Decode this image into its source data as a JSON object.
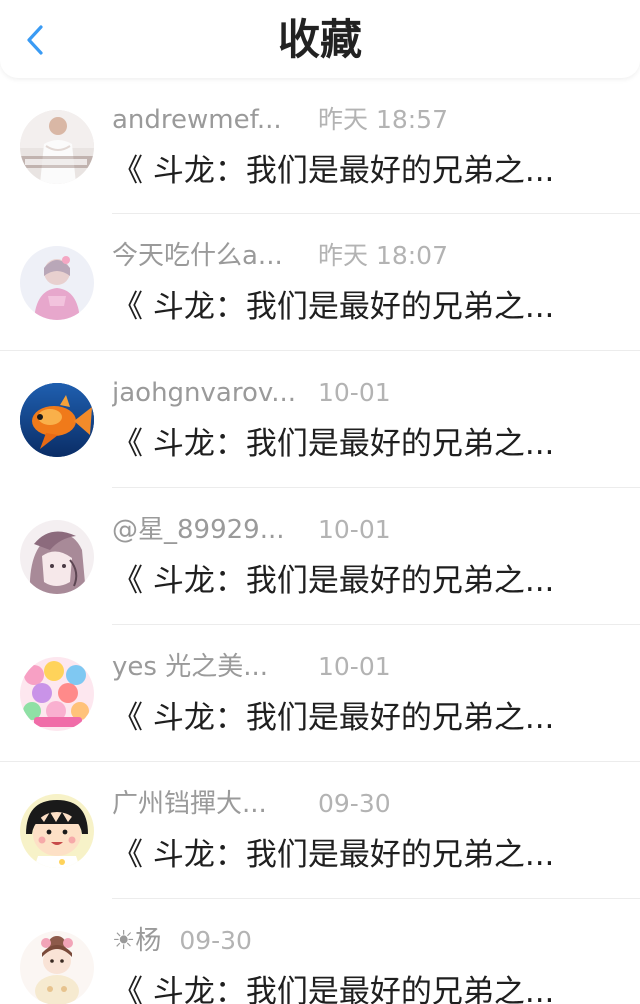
{
  "header": {
    "title": "收藏",
    "back_icon": "chevron-left-icon",
    "accent": "#3a9bf4"
  },
  "items": [
    {
      "name": "andrewmef...",
      "time": "昨天 18:57",
      "snippet": "《 斗龙：我们是最好的兄弟之...",
      "avatar": "avatar-photo-white-shirt"
    },
    {
      "name": "今天吃什么a...",
      "time": "昨天 18:07",
      "snippet": "《 斗龙：我们是最好的兄弟之...",
      "avatar": "avatar-photo-pink-girl"
    },
    {
      "name": "jaohgnvarov...",
      "time": "10-01",
      "snippet": "《 斗龙：我们是最好的兄弟之...",
      "avatar": "avatar-goldfish"
    },
    {
      "name": "@星_89929...",
      "time": "10-01",
      "snippet": "《 斗龙：我们是最好的兄弟之...",
      "avatar": "avatar-anime-girl-sketch"
    },
    {
      "name": "yes 光之美...",
      "time": "10-01",
      "snippet": "《 斗龙：我们是最好的兄弟之...",
      "avatar": "avatar-precure-group"
    },
    {
      "name": "广州铛撣大...",
      "time": "09-30",
      "snippet": "《 斗龙：我们是最好的兄弟之...",
      "avatar": "avatar-cartoon-girl"
    },
    {
      "name": "☀杨",
      "time": "09-30",
      "snippet": "《 斗龙：我们是最好的兄弟之...",
      "avatar": "avatar-doll-girl"
    }
  ]
}
